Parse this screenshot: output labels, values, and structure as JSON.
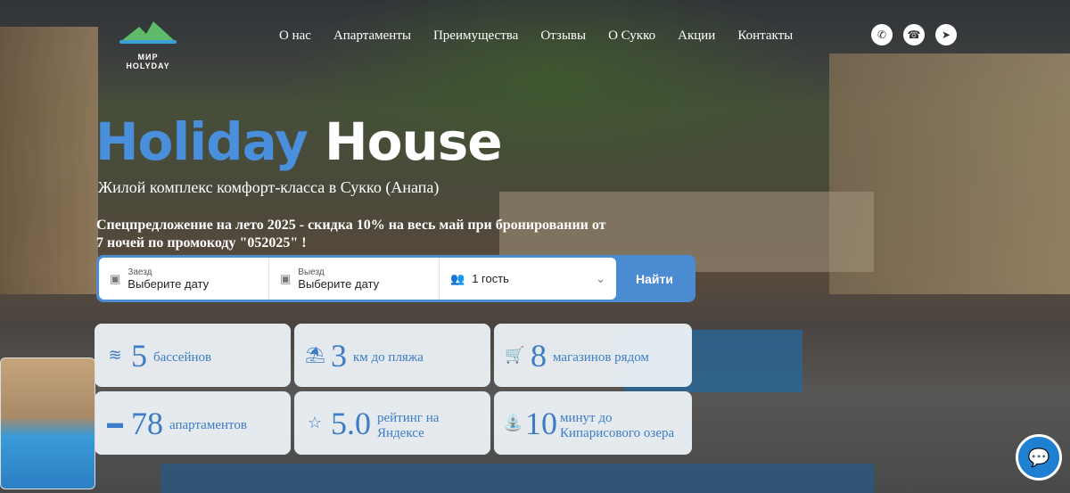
{
  "logo": {
    "text": "МИР HOLYDAY"
  },
  "nav": [
    "О нас",
    "Апартаменты",
    "Преимущества",
    "Отзывы",
    "О Сукко",
    "Акции",
    "Контакты"
  ],
  "social": [
    {
      "icon": "whatsapp-icon",
      "glyph": "✆"
    },
    {
      "icon": "phone-icon",
      "glyph": "☎"
    },
    {
      "icon": "telegram-icon",
      "glyph": "➤"
    }
  ],
  "hero": {
    "title_blue": "Holiday",
    "title_white": "House",
    "subtitle": "Жилой комплекс комфорт-класса в Сукко (Анапа)",
    "promo": "Спецпредложение на лето 2025 - скидка 10% на весь май при бронировании от 7 ночей по промокоду \"052025\" !"
  },
  "search": {
    "checkin_label": "Заезд",
    "checkin_value": "Выберите дату",
    "checkout_label": "Выезд",
    "checkout_value": "Выберите дату",
    "guests": "1 гость",
    "button": "Найти"
  },
  "features": [
    {
      "icon": "swimmer-icon",
      "glyph": "≋",
      "num": "5",
      "label": "бассейнов"
    },
    {
      "icon": "beach-umbrella-icon",
      "glyph": "⛱",
      "num": "3",
      "label": "км до пляжа"
    },
    {
      "icon": "cart-icon",
      "glyph": "🛒",
      "num": "8",
      "label": "магазинов рядом"
    },
    {
      "icon": "bed-icon",
      "glyph": "▬",
      "num": "78",
      "label": "апартаментов"
    },
    {
      "icon": "star-icon",
      "glyph": "☆",
      "num": "5.0",
      "label": "рейтинг на Яндексе"
    },
    {
      "icon": "lake-icon",
      "glyph": "⛲",
      "num": "10",
      "label": "минут до Кипарисового озера"
    }
  ],
  "colors": {
    "accent": "#4a8bd2",
    "text_blue": "#3d7cc6"
  }
}
